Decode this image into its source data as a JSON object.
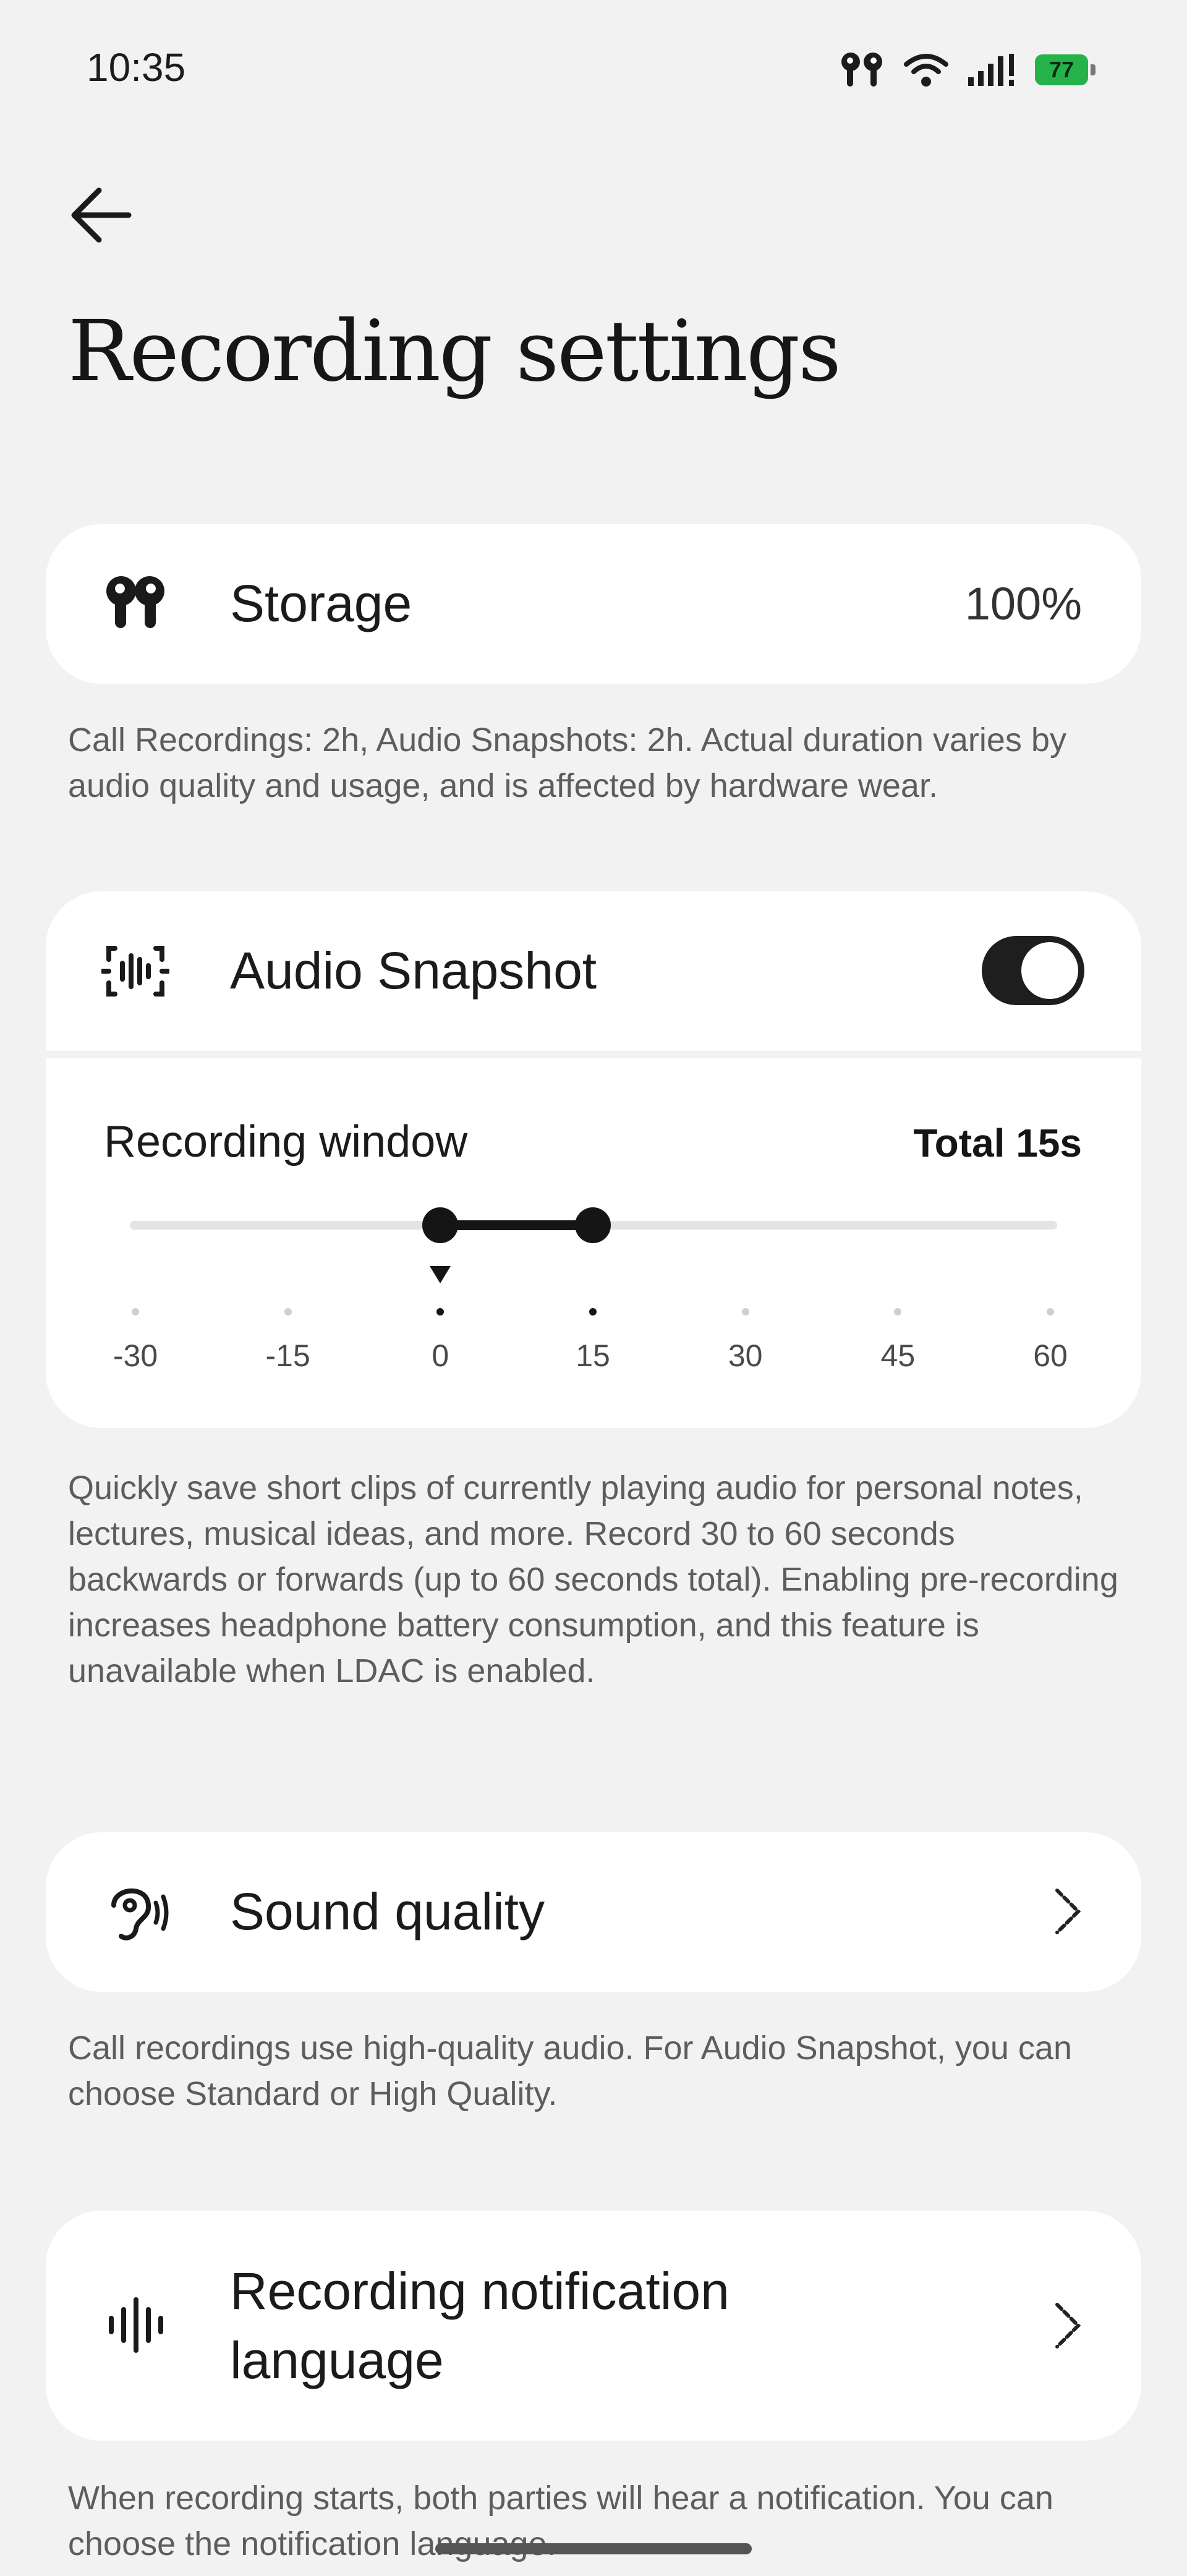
{
  "status_bar": {
    "time": "10:35",
    "battery": "77",
    "icons": [
      "earbuds-icon",
      "wifi-icon",
      "signal-icon",
      "battery-icon"
    ]
  },
  "header": {
    "back_icon": "back-arrow-icon",
    "title": "Recording settings"
  },
  "storage": {
    "icon": "earbuds-icon",
    "label": "Storage",
    "value": "100%",
    "description": "Call Recordings: 2h, Audio Snapshots: 2h. Actual duration varies by audio quality and usage, and is affected by hardware wear."
  },
  "audio_snapshot": {
    "icon": "audio-snapshot-icon",
    "label": "Audio Snapshot",
    "enabled": true,
    "recording_window": {
      "label": "Recording window",
      "total": "Total 15s",
      "range_start": 0,
      "range_end": 15,
      "current_marker": 0,
      "ticks": [
        "-30",
        "-15",
        "0",
        "15",
        "30",
        "45",
        "60"
      ]
    },
    "description": "Quickly save short clips of currently playing audio for personal notes, lectures, musical ideas, and more. Record 30 to 60 seconds backwards or forwards (up to 60 seconds total). Enabling pre-recording increases headphone battery consumption, and this feature is unavailable when LDAC is enabled."
  },
  "sound_quality": {
    "icon": "ear-sound-icon",
    "label": "Sound quality",
    "description": "Call recordings use high-quality audio. For Audio Snapshot, you can choose Standard or High Quality."
  },
  "notification_language": {
    "icon": "waveform-icon",
    "label": "Recording notification language",
    "description": "When recording starts, both parties will hear a notification. You can choose the notification language."
  },
  "colors": {
    "background": "#f2f2f2",
    "card": "#ffffff",
    "accent": "#151515",
    "battery": "#26b24a"
  }
}
